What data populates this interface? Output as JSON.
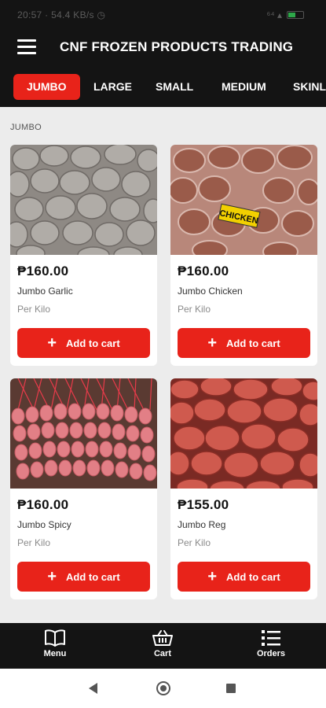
{
  "status_bar": {
    "time": "20:57 · 54.4 KB/s ◷",
    "right": "⁶⁴ ▴"
  },
  "app": {
    "title": "CNF FROZEN PRODUCTS TRADING"
  },
  "tabs": [
    "JUMBO",
    "LARGE",
    "SMALL",
    "MEDIUM",
    "SKINL"
  ],
  "section_label": "JUMBO",
  "products": [
    {
      "price": "₱160.00",
      "name": "Jumbo Garlic",
      "unit": "Per Kilo",
      "button": "Add to cart"
    },
    {
      "price": "₱160.00",
      "name": "Jumbo Chicken",
      "unit": "Per Kilo",
      "button": "Add to cart",
      "image_tag": "CHICKEN"
    },
    {
      "price": "₱160.00",
      "name": "Jumbo Spicy",
      "unit": "Per Kilo",
      "button": "Add to cart"
    },
    {
      "price": "₱155.00",
      "name": "Jumbo Reg",
      "unit": "Per Kilo",
      "button": "Add to cart"
    }
  ],
  "bottom_nav": [
    {
      "label": "Menu",
      "icon": "book-icon"
    },
    {
      "label": "Cart",
      "icon": "basket-icon"
    },
    {
      "label": "Orders",
      "icon": "list-icon"
    }
  ],
  "colors": {
    "accent": "#e8231a",
    "bar": "#141414",
    "background": "#ececec"
  }
}
